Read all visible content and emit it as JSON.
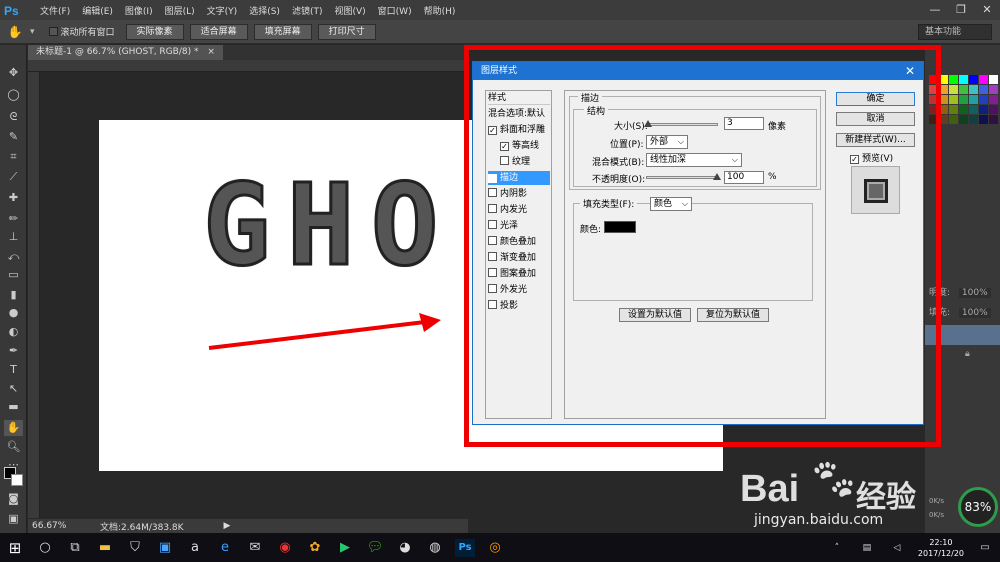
{
  "menubar": {
    "logo": "Ps",
    "items": [
      "文件(F)",
      "编辑(E)",
      "图像(I)",
      "图层(L)",
      "文字(Y)",
      "选择(S)",
      "滤镜(T)",
      "视图(V)",
      "窗口(W)",
      "帮助(H)"
    ]
  },
  "optionsbar": {
    "scroll_all_label": "滚动所有窗口",
    "buttons": [
      "实际像素",
      "适合屏幕",
      "填充屏幕",
      "打印尺寸"
    ],
    "workspace": "基本功能"
  },
  "document": {
    "tab_title": "未标题-1 @ 66.7% (GHOST, RGB/8) *",
    "letters": [
      "G",
      "H",
      "O"
    ],
    "zoom": "66.67%",
    "doc_info": "文档:2.64M/383.8K"
  },
  "dialog": {
    "title": "图层样式",
    "styles_header": "样式",
    "blend_options": "混合选项:默认",
    "effects": [
      {
        "label": "斜面和浮雕",
        "checked": true,
        "indent": false,
        "selected": false
      },
      {
        "label": "等高线",
        "checked": true,
        "indent": true,
        "selected": false
      },
      {
        "label": "纹理",
        "checked": false,
        "indent": true,
        "selected": false
      },
      {
        "label": "描边",
        "checked": true,
        "indent": false,
        "selected": true
      },
      {
        "label": "内阴影",
        "checked": false,
        "indent": false,
        "selected": false
      },
      {
        "label": "内发光",
        "checked": false,
        "indent": false,
        "selected": false
      },
      {
        "label": "光泽",
        "checked": false,
        "indent": false,
        "selected": false
      },
      {
        "label": "颜色叠加",
        "checked": false,
        "indent": false,
        "selected": false
      },
      {
        "label": "渐变叠加",
        "checked": false,
        "indent": false,
        "selected": false
      },
      {
        "label": "图案叠加",
        "checked": false,
        "indent": false,
        "selected": false
      },
      {
        "label": "外发光",
        "checked": false,
        "indent": false,
        "selected": false
      },
      {
        "label": "投影",
        "checked": false,
        "indent": false,
        "selected": false
      }
    ],
    "stroke": {
      "section_title": "描边",
      "structure_title": "结构",
      "size_label": "大小(S):",
      "size_value": "3",
      "size_unit": "像素",
      "size_slider": 0.02,
      "position_label": "位置(P):",
      "position_value": "外部",
      "blend_label": "混合模式(B):",
      "blend_value": "线性加深",
      "opacity_label": "不透明度(O):",
      "opacity_value": "100",
      "opacity_unit": "%",
      "opacity_slider": 1.0,
      "fill_type_label": "填充类型(F):",
      "fill_type_value": "颜色",
      "color_label": "颜色:",
      "color_value": "#000000"
    },
    "buttons": {
      "set_default": "设置为默认值",
      "reset_default": "复位为默认值",
      "ok": "确定",
      "cancel": "取消",
      "new_style": "新建样式(W)...",
      "preview_label": "预览(V)"
    }
  },
  "right_panel": {
    "opacity_label": "明度:",
    "opacity_value": "100%",
    "fill_label": "填充:",
    "fill_value": "100%",
    "gauge": "83%",
    "speed_up": "0K/s",
    "speed_down": "0K/s"
  },
  "taskbar": {
    "time": "22:10",
    "date": "2017/12/20"
  },
  "watermark": {
    "brand": "Bai",
    "brand2": "经验",
    "url": "jingyan.baidu.com"
  },
  "colors": {
    "annotation_red": "#ee0000",
    "dialog_title_blue": "#1e73d2",
    "selection_blue": "#3399ff"
  }
}
